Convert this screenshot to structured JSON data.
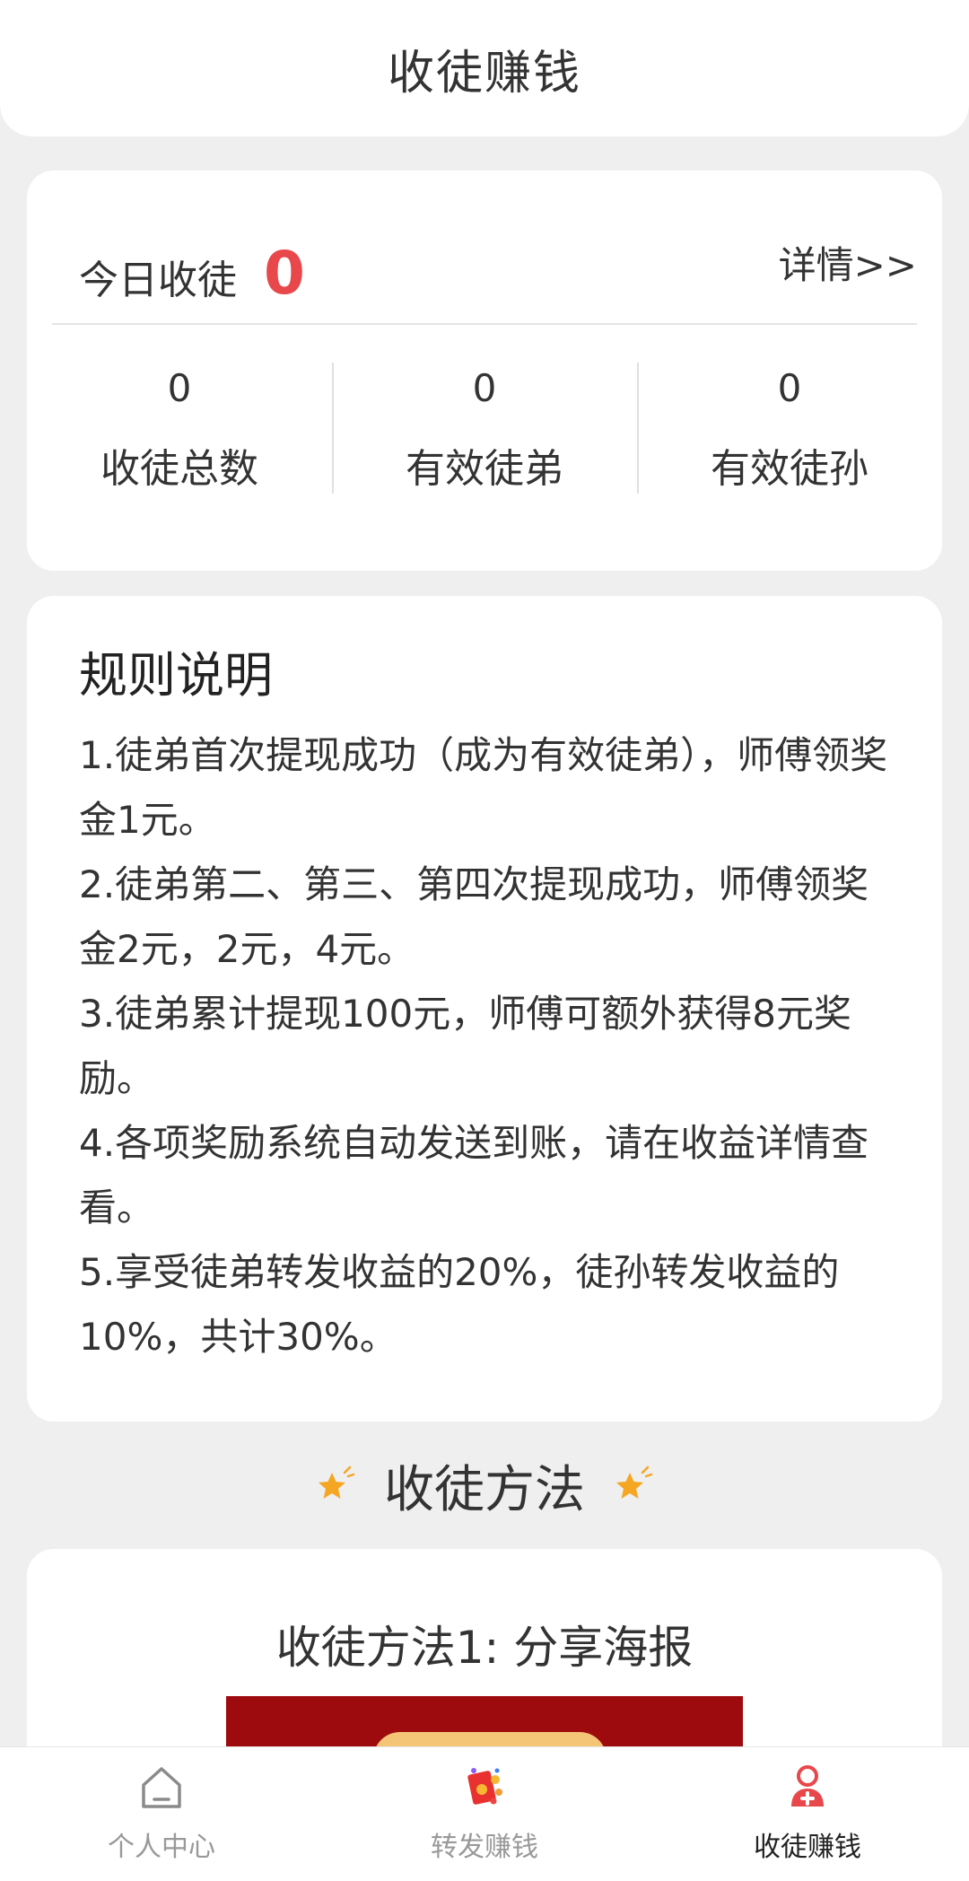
{
  "header": {
    "title": "收徒赚钱"
  },
  "stats": {
    "today_label": "今日收徒",
    "today_value": "0",
    "details_link": "详情>>",
    "items": [
      {
        "value": "0",
        "label": "收徒总数"
      },
      {
        "value": "0",
        "label": "有效徒弟"
      },
      {
        "value": "0",
        "label": "有效徒孙"
      }
    ]
  },
  "rules": {
    "title": "规则说明",
    "items": [
      "1.徒弟首次提现成功（成为有效徒弟），师傅领奖金1元。",
      "2.徒弟第二、第三、第四次提现成功，师傅领奖金2元，2元，4元。",
      "3.徒弟累计提现100元，师傅可额外获得8元奖励。",
      "4.各项奖励系统自动发送到账，请在收益详情查看。",
      "5.享受徒弟转发收益的20%，徒孙转发收益的10%，共计30%。"
    ]
  },
  "methods": {
    "heading": "收徒方法",
    "method1_title": "收徒方法1: 分享海报"
  },
  "tabbar": {
    "tabs": [
      {
        "label": "个人中心",
        "icon": "home-icon"
      },
      {
        "label": "转发赚钱",
        "icon": "red-packet-icon"
      },
      {
        "label": "收徒赚钱",
        "icon": "add-person-icon"
      }
    ],
    "active_index": 2
  },
  "colors": {
    "accent_red": "#e8484b",
    "star_orange": "#f5a623",
    "poster_red": "#9e0b0e"
  }
}
